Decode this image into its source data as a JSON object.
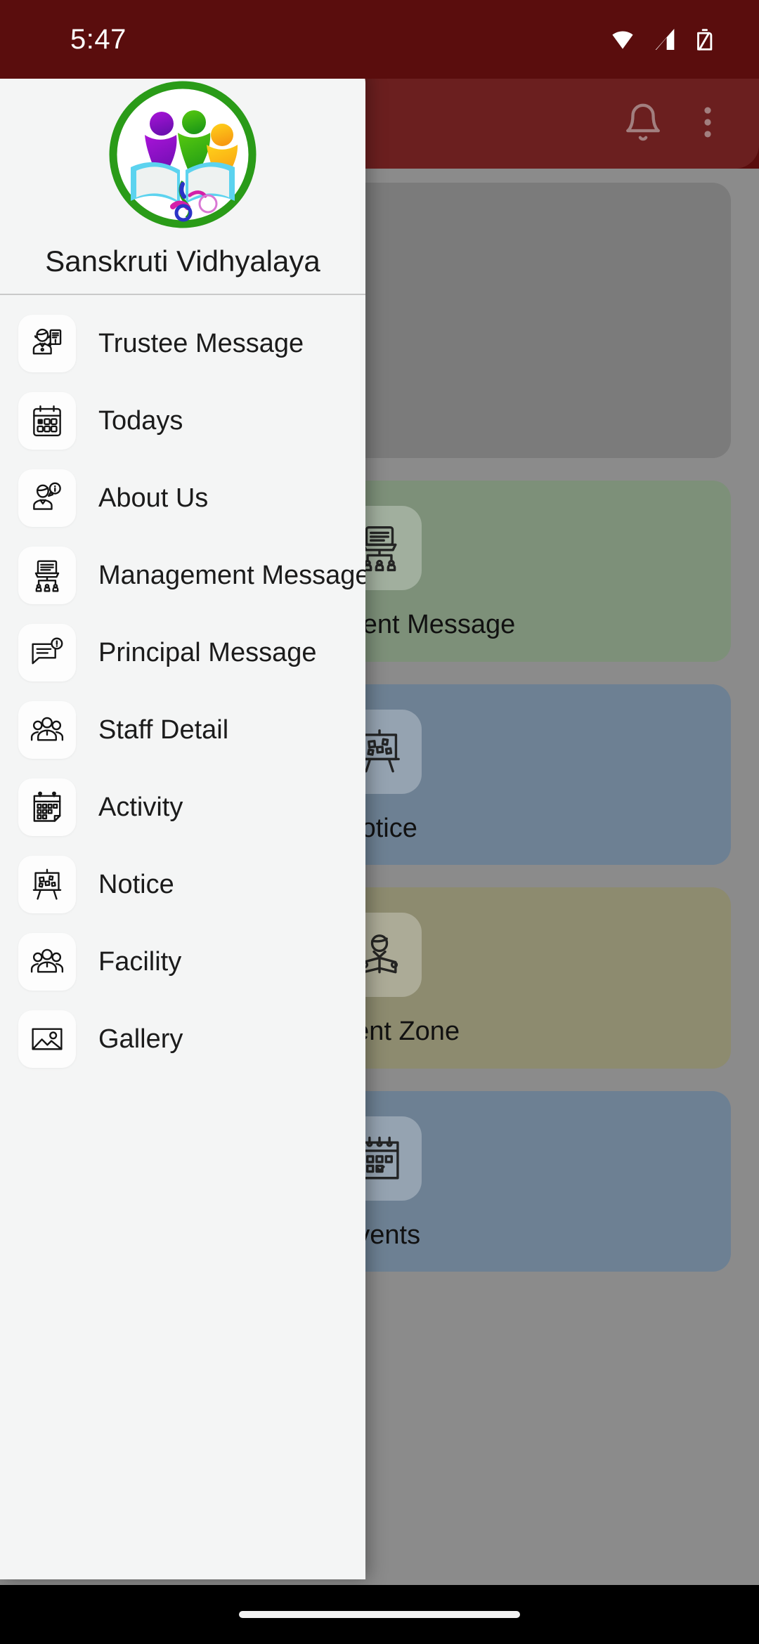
{
  "status_bar": {
    "time": "5:47",
    "icons": [
      "wifi-icon",
      "cellular-signal-icon",
      "battery-icon"
    ]
  },
  "app_bar": {
    "notifications_icon": "bell-icon",
    "overflow_icon": "more-vertical-icon"
  },
  "drawer": {
    "school_name": "Sanskruti Vidhyalaya",
    "logo_icon": "school-logo",
    "items": [
      {
        "label": "Trustee Message",
        "icon": "trustee-message-icon"
      },
      {
        "label": "Todays",
        "icon": "calendar-today-icon"
      },
      {
        "label": "About Us",
        "icon": "about-us-icon"
      },
      {
        "label": "Management Message",
        "icon": "management-message-icon"
      },
      {
        "label": "Principal Message",
        "icon": "principal-message-icon"
      },
      {
        "label": "Staff Detail",
        "icon": "staff-group-icon"
      },
      {
        "label": "Activity",
        "icon": "activity-calendar-icon"
      },
      {
        "label": "Notice",
        "icon": "notice-board-icon"
      },
      {
        "label": "Facility",
        "icon": "facility-group-icon"
      },
      {
        "label": "Gallery",
        "icon": "gallery-image-icon"
      }
    ]
  },
  "home_grid": {
    "cards": [
      {
        "label": "Management Message",
        "icon": "management-message-icon",
        "color": "#7d9079"
      },
      {
        "label": "Notice",
        "icon": "notice-board-icon",
        "color": "#6d8093"
      },
      {
        "label": "Student Zone",
        "icon": "student-zone-icon",
        "color": "#8d8b6f"
      },
      {
        "label": "Events",
        "icon": "events-calendar-icon",
        "color": "#6d8093"
      }
    ]
  },
  "theme": {
    "primary": "#5a0d0d",
    "drawer_bg": "#f4f5f5",
    "scrim": "#8b8b8b"
  }
}
